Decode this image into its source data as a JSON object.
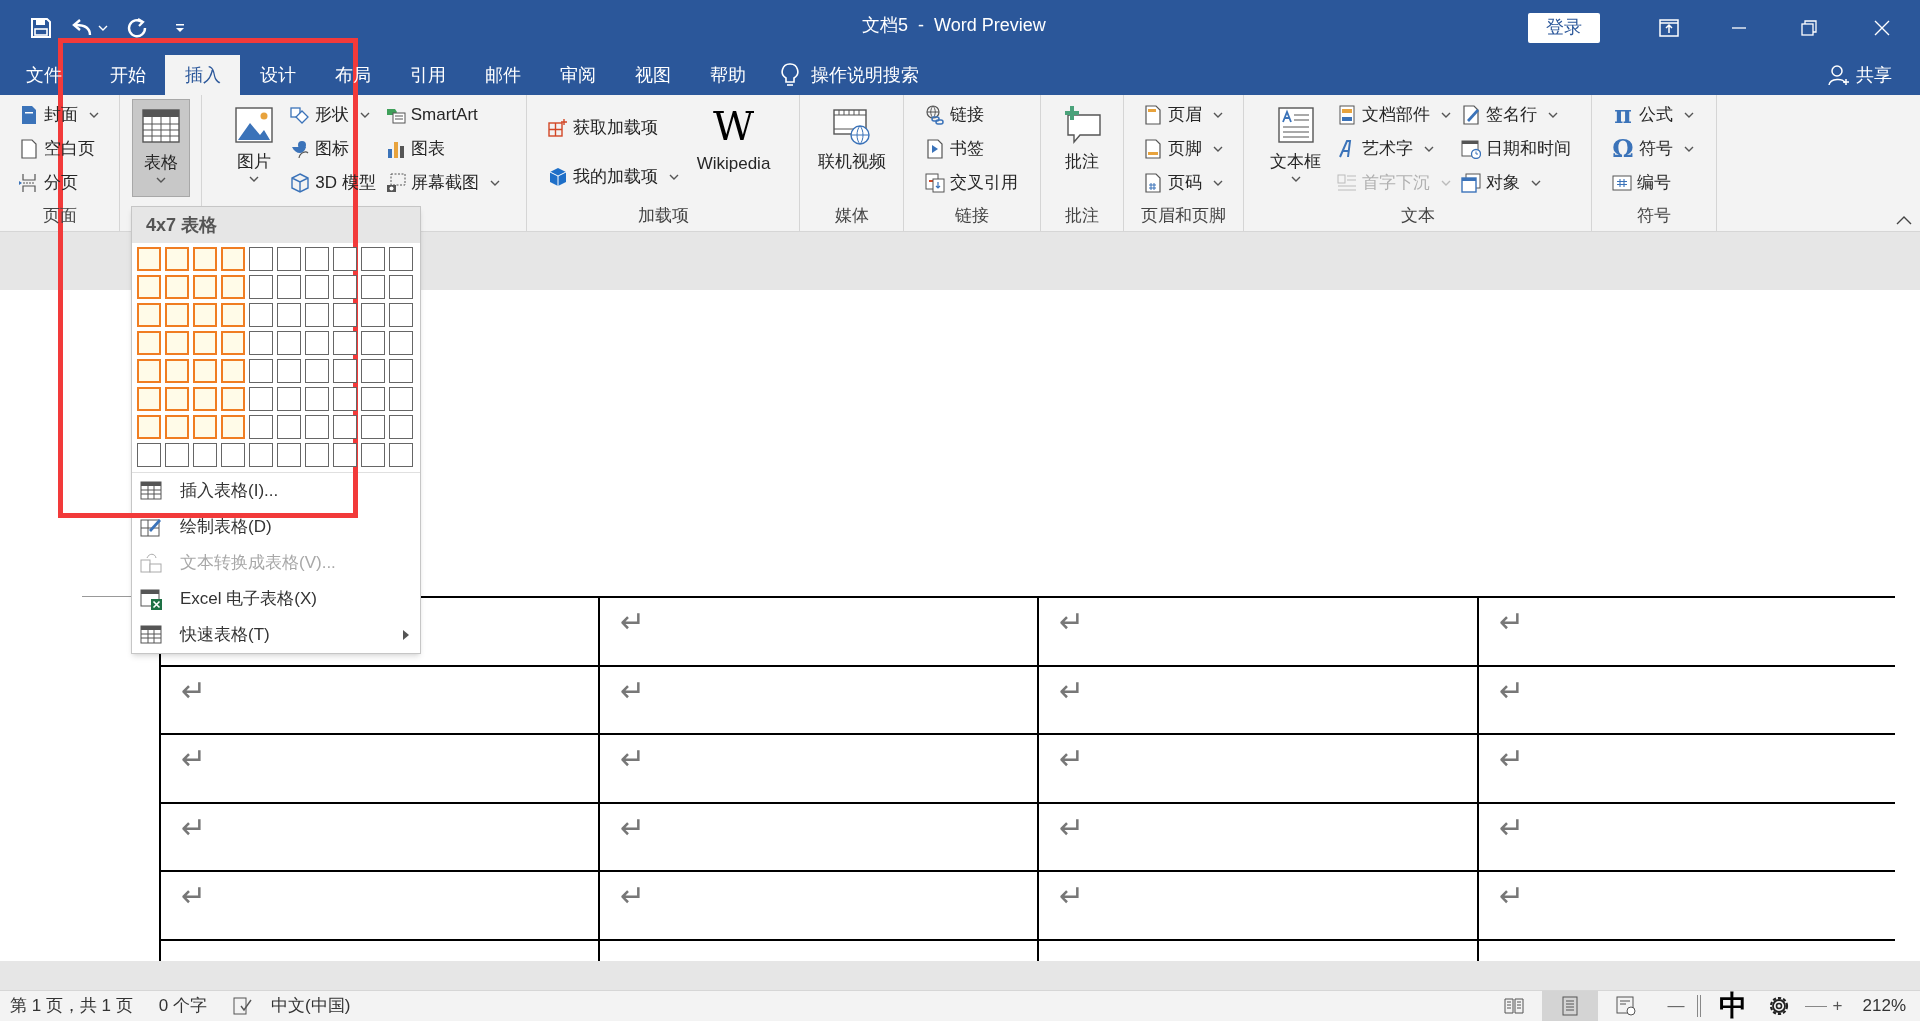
{
  "title_bar": {
    "title": "文档5  -  Word Preview",
    "sign_in": "登录"
  },
  "tabs": [
    {
      "label": "文件",
      "selected": false
    },
    {
      "label": "开始",
      "selected": false
    },
    {
      "label": "插入",
      "selected": true
    },
    {
      "label": "设计",
      "selected": false
    },
    {
      "label": "布局",
      "selected": false
    },
    {
      "label": "引用",
      "selected": false
    },
    {
      "label": "邮件",
      "selected": false
    },
    {
      "label": "审阅",
      "selected": false
    },
    {
      "label": "视图",
      "selected": false
    },
    {
      "label": "帮助",
      "selected": false
    }
  ],
  "tell_me": {
    "placeholder": "操作说明搜索"
  },
  "share": "共享",
  "ribbon": {
    "groups": [
      {
        "label": "页面",
        "columns": [
          [
            {
              "kind": "small",
              "label": "封面",
              "dropdown": true,
              "disabled": false,
              "pressed": false
            },
            {
              "kind": "small",
              "label": "空白页",
              "dropdown": false,
              "disabled": false,
              "pressed": false
            },
            {
              "kind": "small",
              "label": "分页",
              "dropdown": false,
              "disabled": false,
              "pressed": false
            }
          ]
        ]
      },
      {
        "columns": [
          [
            {
              "kind": "large",
              "label": "表格",
              "dropdown": true,
              "disabled": false,
              "pressed": true
            }
          ]
        ]
      },
      {
        "columns": [
          [
            {
              "kind": "large",
              "label": "图片",
              "dropdown": true,
              "disabled": false,
              "pressed": false
            }
          ],
          [
            {
              "kind": "small",
              "label": "形状",
              "dropdown": true,
              "disabled": false,
              "pressed": false
            },
            {
              "kind": "small",
              "label": "图标",
              "dropdown": false,
              "disabled": false,
              "pressed": false
            },
            {
              "kind": "small",
              "label": "3D 模型",
              "dropdown": false,
              "disabled": false,
              "pressed": false
            }
          ],
          [
            {
              "kind": "small",
              "label": "SmartArt",
              "dropdown": false,
              "disabled": false,
              "pressed": false
            },
            {
              "kind": "small",
              "label": "图表",
              "dropdown": false,
              "disabled": false,
              "pressed": false
            },
            {
              "kind": "small",
              "label": "屏幕截图",
              "dropdown": true,
              "disabled": false,
              "pressed": false
            }
          ]
        ]
      },
      {
        "label": "加载项",
        "columns": [
          [
            {
              "kind": "small",
              "label": "获取加载项",
              "dropdown": false,
              "disabled": false,
              "pressed": false
            },
            {
              "kind": "small",
              "label": "我的加载项",
              "dropdown": true,
              "disabled": false,
              "pressed": false
            }
          ],
          [
            {
              "kind": "large",
              "label": "Wikipedia",
              "glyph": "W",
              "dropdown": false,
              "disabled": false,
              "pressed": false
            }
          ]
        ]
      },
      {
        "label": "媒体",
        "columns": [
          [
            {
              "kind": "large",
              "label": "联机视频",
              "dropdown": false,
              "disabled": false,
              "pressed": false
            }
          ]
        ]
      },
      {
        "label": "链接",
        "columns": [
          [
            {
              "kind": "small",
              "label": "链接",
              "dropdown": false,
              "disabled": false,
              "pressed": false
            },
            {
              "kind": "small",
              "label": "书签",
              "dropdown": false,
              "disabled": false,
              "pressed": false
            },
            {
              "kind": "small",
              "label": "交叉引用",
              "dropdown": false,
              "disabled": false,
              "pressed": false
            }
          ]
        ]
      },
      {
        "label": "批注",
        "columns": [
          [
            {
              "kind": "large",
              "label": "批注",
              "dropdown": false,
              "disabled": false,
              "pressed": false
            }
          ]
        ]
      },
      {
        "label": "页眉和页脚",
        "columns": [
          [
            {
              "kind": "small",
              "label": "页眉",
              "dropdown": true,
              "disabled": false,
              "pressed": false
            },
            {
              "kind": "small",
              "label": "页脚",
              "dropdown": true,
              "disabled": false,
              "pressed": false
            },
            {
              "kind": "small",
              "label": "页码",
              "dropdown": true,
              "disabled": false,
              "pressed": false
            }
          ]
        ]
      },
      {
        "label": "文本",
        "columns": [
          [
            {
              "kind": "large",
              "label": "文本框",
              "dropdown": true,
              "disabled": false,
              "pressed": false
            }
          ],
          [
            {
              "kind": "small",
              "label": "文档部件",
              "dropdown": true,
              "disabled": false,
              "pressed": false
            },
            {
              "kind": "small",
              "label": "艺术字",
              "dropdown": true,
              "disabled": false,
              "pressed": false
            },
            {
              "kind": "small",
              "label": "首字下沉",
              "dropdown": true,
              "disabled": true,
              "pressed": false
            }
          ],
          [
            {
              "kind": "small",
              "label": "签名行",
              "dropdown": true,
              "disabled": false,
              "pressed": false
            },
            {
              "kind": "small",
              "label": "日期和时间",
              "dropdown": false,
              "disabled": false,
              "pressed": false
            },
            {
              "kind": "small",
              "label": "对象",
              "dropdown": true,
              "disabled": false,
              "pressed": false
            }
          ]
        ]
      },
      {
        "label": "符号",
        "columns": [
          [
            {
              "kind": "small",
              "label": "公式",
              "glyph": "π",
              "dropdown": true,
              "disabled": false,
              "pressed": false
            },
            {
              "kind": "small",
              "label": "符号",
              "glyph": "Ω",
              "dropdown": true,
              "disabled": false,
              "pressed": false
            },
            {
              "kind": "small",
              "label": "编号",
              "dropdown": false,
              "disabled": false,
              "pressed": false
            }
          ]
        ]
      }
    ]
  },
  "table_menu": {
    "header": "4x7 表格",
    "grid": [
      {
        "cells": [
          {
            "selected": true
          },
          {
            "selected": true
          },
          {
            "selected": true
          },
          {
            "selected": true
          },
          {
            "selected": false
          },
          {
            "selected": false
          },
          {
            "selected": false
          },
          {
            "selected": false
          },
          {
            "selected": false
          },
          {
            "selected": false
          }
        ]
      },
      {
        "cells": [
          {
            "selected": true
          },
          {
            "selected": true
          },
          {
            "selected": true
          },
          {
            "selected": true
          },
          {
            "selected": false
          },
          {
            "selected": false
          },
          {
            "selected": false
          },
          {
            "selected": false
          },
          {
            "selected": false
          },
          {
            "selected": false
          }
        ]
      },
      {
        "cells": [
          {
            "selected": true
          },
          {
            "selected": true
          },
          {
            "selected": true
          },
          {
            "selected": true
          },
          {
            "selected": false
          },
          {
            "selected": false
          },
          {
            "selected": false
          },
          {
            "selected": false
          },
          {
            "selected": false
          },
          {
            "selected": false
          }
        ]
      },
      {
        "cells": [
          {
            "selected": true
          },
          {
            "selected": true
          },
          {
            "selected": true
          },
          {
            "selected": true
          },
          {
            "selected": false
          },
          {
            "selected": false
          },
          {
            "selected": false
          },
          {
            "selected": false
          },
          {
            "selected": false
          },
          {
            "selected": false
          }
        ]
      },
      {
        "cells": [
          {
            "selected": true
          },
          {
            "selected": true
          },
          {
            "selected": true
          },
          {
            "selected": true
          },
          {
            "selected": false
          },
          {
            "selected": false
          },
          {
            "selected": false
          },
          {
            "selected": false
          },
          {
            "selected": false
          },
          {
            "selected": false
          }
        ]
      },
      {
        "cells": [
          {
            "selected": true
          },
          {
            "selected": true
          },
          {
            "selected": true
          },
          {
            "selected": true
          },
          {
            "selected": false
          },
          {
            "selected": false
          },
          {
            "selected": false
          },
          {
            "selected": false
          },
          {
            "selected": false
          },
          {
            "selected": false
          }
        ]
      },
      {
        "cells": [
          {
            "selected": true
          },
          {
            "selected": true
          },
          {
            "selected": true
          },
          {
            "selected": true
          },
          {
            "selected": false
          },
          {
            "selected": false
          },
          {
            "selected": false
          },
          {
            "selected": false
          },
          {
            "selected": false
          },
          {
            "selected": false
          }
        ]
      },
      {
        "cells": [
          {
            "selected": false
          },
          {
            "selected": false
          },
          {
            "selected": false
          },
          {
            "selected": false
          },
          {
            "selected": false
          },
          {
            "selected": false
          },
          {
            "selected": false
          },
          {
            "selected": false
          },
          {
            "selected": false
          },
          {
            "selected": false
          }
        ]
      }
    ],
    "items": [
      {
        "label": "插入表格(I)...",
        "disabled": false,
        "submenu": false
      },
      {
        "label": "绘制表格(D)",
        "disabled": false,
        "submenu": false
      },
      {
        "label": "文本转换成表格(V)...",
        "disabled": true,
        "submenu": false
      },
      {
        "label": "Excel 电子表格(X)",
        "disabled": false,
        "submenu": false
      },
      {
        "label": "快速表格(T)",
        "disabled": false,
        "submenu": true
      }
    ]
  },
  "document_table": {
    "rows": [
      {
        "cells": [
          {},
          {
            "text": "↵"
          },
          {
            "text": "↵"
          },
          {
            "text": "↵"
          }
        ]
      },
      {
        "cells": [
          {
            "text": "↵"
          },
          {
            "text": "↵"
          },
          {
            "text": "↵"
          },
          {
            "text": "↵"
          }
        ]
      },
      {
        "cells": [
          {
            "text": "↵"
          },
          {
            "text": "↵"
          },
          {
            "text": "↵"
          },
          {
            "text": "↵"
          }
        ]
      },
      {
        "cells": [
          {
            "text": "↵"
          },
          {
            "text": "↵"
          },
          {
            "text": "↵"
          },
          {
            "text": "↵"
          }
        ]
      },
      {
        "cells": [
          {
            "text": "↵"
          },
          {
            "text": "↵"
          },
          {
            "text": "↵"
          },
          {
            "text": "↵"
          }
        ]
      },
      {
        "cells": [
          {},
          {},
          {},
          {}
        ]
      }
    ]
  },
  "status_bar": {
    "page": "第 1 页，共 1 页",
    "words": "0 个字",
    "language": "中文(中国)",
    "views": [
      {
        "selected": false
      },
      {
        "selected": true
      },
      {
        "selected": false
      }
    ],
    "zoom_out": "—",
    "ime": "中",
    "zoom_in": "+",
    "zoom": "212%"
  }
}
